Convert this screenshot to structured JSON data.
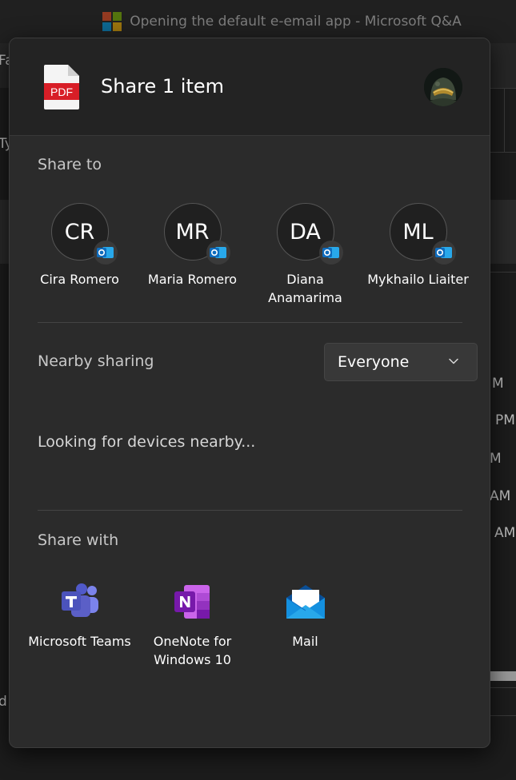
{
  "background_window": {
    "title": "Opening the default e-email app - Microsoft Q&A",
    "right_fragments": [
      "M",
      "PM",
      "M",
      "AM",
      "AM"
    ],
    "left_fragments": [
      "Fa",
      "Ty",
      "d"
    ]
  },
  "dialog": {
    "title": "Share 1 item",
    "file_icon_label": "PDF",
    "share_to": {
      "label": "Share to",
      "contacts": [
        {
          "initials": "CR",
          "name": "Cira Romero"
        },
        {
          "initials": "MR",
          "name": "Maria Romero"
        },
        {
          "initials": "DA",
          "name": "Diana Anamarima"
        },
        {
          "initials": "ML",
          "name": "Mykhailo Liaiter"
        }
      ]
    },
    "nearby": {
      "label": "Nearby sharing",
      "dropdown_value": "Everyone",
      "status": "Looking for devices nearby..."
    },
    "share_with": {
      "label": "Share with",
      "apps": [
        {
          "name": "Microsoft Teams",
          "icon": "teams-icon"
        },
        {
          "name": "OneNote for Windows 10",
          "icon": "onenote-icon"
        },
        {
          "name": "Mail",
          "icon": "mail-icon"
        }
      ]
    }
  },
  "colors": {
    "dialog_bg": "#2b2b2b",
    "header_bg": "#232323",
    "pdf_red": "#d81e27",
    "outlook_blue": "#0f6cbd",
    "teams_purple": "#5b5fc7",
    "onenote_purple": "#7719aa",
    "mail_blue": "#0a7cd7"
  }
}
